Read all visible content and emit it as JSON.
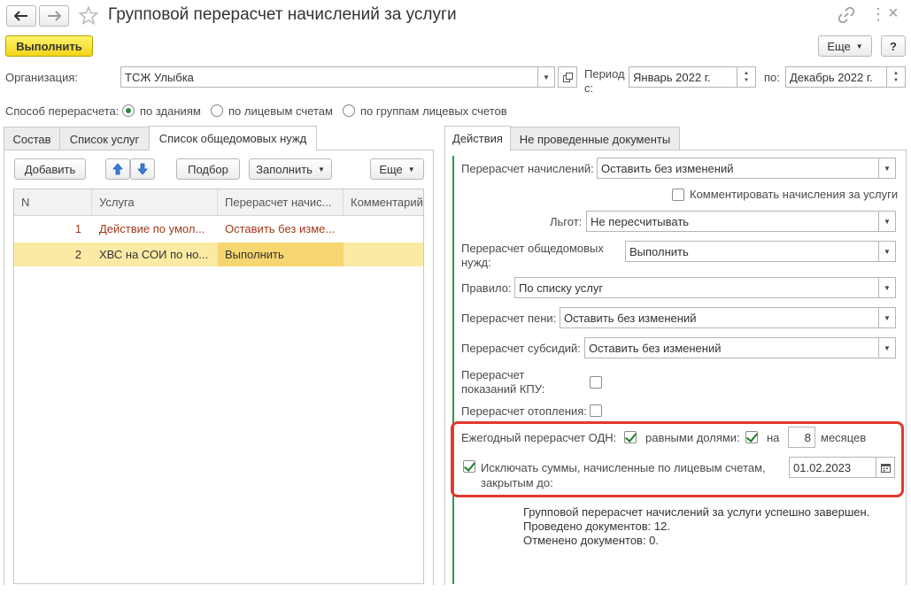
{
  "window": {
    "title": "Групповой перерасчет начислений за услуги"
  },
  "toolbar": {
    "execute_label": "Выполнить",
    "more_label": "Еще",
    "help_label": "?"
  },
  "header": {
    "organization_label": "Организация:",
    "organization_value": "ТСЖ Улыбка",
    "period_label_1": "Период",
    "period_label_2": "с:",
    "period_from": "Январь 2022 г.",
    "period_to_label": "по:",
    "period_to": "Декабрь 2022 г."
  },
  "method": {
    "label": "Способ перерасчета:",
    "options": [
      "по зданиям",
      "по лицевым счетам",
      "по группам лицевых счетов"
    ],
    "selected": 0
  },
  "left_tabs": [
    "Состав",
    "Список услуг",
    "Список общедомовых нужд"
  ],
  "left_toolbar": {
    "add": "Добавить",
    "select": "Подбор",
    "fill": "Заполнить",
    "more": "Еще"
  },
  "table": {
    "columns": [
      "N",
      "Услуга",
      "Перерасчет начис...",
      "Комментарий"
    ],
    "rows": [
      {
        "n": "1",
        "service": "Действие по умол...",
        "recalc": "Оставить без изме...",
        "comment": ""
      },
      {
        "n": "2",
        "service": "ХВС на СОИ по но...",
        "recalc": "Выполнить",
        "comment": ""
      }
    ]
  },
  "right_tabs": [
    "Действия",
    "Не проведенные документы"
  ],
  "actions": {
    "recalc_charges_label": "Перерасчет начислений:",
    "recalc_charges_value": "Оставить без изменений",
    "comment_charges_label": "Комментировать начисления за услуги",
    "benefits_label": "Льгот:",
    "benefits_value": "Не пересчитывать",
    "common_needs_label_1": "Перерасчет общедомовых",
    "common_needs_label_2": "нужд:",
    "common_needs_value": "Выполнить",
    "rule_label": "Правило:",
    "rule_value": "По списку услуг",
    "penalty_label": "Перерасчет пени:",
    "penalty_value": "Оставить без изменений",
    "subsidy_label": "Перерасчет субсидий:",
    "subsidy_value": "Оставить без изменений",
    "kpu_label_1": "Перерасчет",
    "kpu_label_2": "показаний КПУ:",
    "heating_label": "Перерасчет отопления:",
    "annual_odn_label": "Ежегодный перерасчет ОДН:",
    "equal_parts_label": "равными долями:",
    "on_label": "на",
    "months_value": "8",
    "months_label": "месяцев",
    "exclude_label_1": "Исключать суммы, начисленные по лицевым счетам,",
    "exclude_label_2": "закрытым до:",
    "exclude_date": "01.02.2023"
  },
  "result": {
    "line1": "Групповой перерасчет начислений за услуги успешно завершен.",
    "line2": "Проведено документов: 12.",
    "line3": "Отменено документов: 0."
  },
  "colors": {
    "accent_yellow": "#f5dc2a",
    "green_bar": "#2e9a48",
    "highlight_red": "#e03a2e",
    "selected_row": "#fbeaa4",
    "row_text_red": "#a0391c"
  }
}
